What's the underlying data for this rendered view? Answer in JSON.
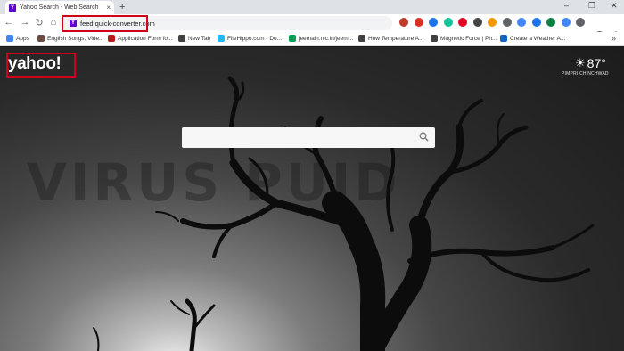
{
  "browser": {
    "tab_title": "Yahoo Search - Web Search",
    "tab_close": "×",
    "new_tab": "+",
    "window_controls": [
      "–",
      "❐",
      "✕"
    ],
    "url": "feed.quick-converter.com",
    "nav": {
      "back": "←",
      "forward": "→",
      "reload": "↻",
      "home": "⌂"
    },
    "menu": "⋮",
    "extensions": [
      {
        "name": "abp-icon",
        "color": "#c0392b"
      },
      {
        "name": "calendar-icon",
        "color": "#d93025"
      },
      {
        "name": "shield-icon",
        "color": "#1a73e8"
      },
      {
        "name": "grammarly-icon",
        "color": "#15c39a"
      },
      {
        "name": "pinterest-icon",
        "color": "#e60023"
      },
      {
        "name": "puzzle-icon",
        "color": "#444444"
      },
      {
        "name": "gear-icon",
        "color": "#f29900"
      },
      {
        "name": "s-icon",
        "color": "#5f6368"
      },
      {
        "name": "pen-icon",
        "color": "#4285f4"
      },
      {
        "name": "video-icon",
        "color": "#1a73e8"
      },
      {
        "name": "chat-icon",
        "color": "#0b8043"
      },
      {
        "name": "mail-icon",
        "color": "#4285f4"
      },
      {
        "name": "cast-icon",
        "color": "#5f6368"
      }
    ]
  },
  "bookmarks": {
    "items": [
      {
        "label": "Apps",
        "icon": "apps-icon",
        "color": "#4285f4"
      },
      {
        "label": "English Songs, Vide...",
        "icon": "bookmark-icon",
        "color": "#6d4c41"
      },
      {
        "label": "Application Form fo...",
        "icon": "globe-icon",
        "color": "#b71c1c"
      },
      {
        "label": "New Tab",
        "icon": "globe-icon",
        "color": "#424242"
      },
      {
        "label": "FileHippo.com - Do...",
        "icon": "hippo-icon",
        "color": "#29b6f6"
      },
      {
        "label": "jeemain.nic.in/jeem...",
        "icon": "chrome-icon",
        "color": "#0f9d58"
      },
      {
        "label": "How Temperature A...",
        "icon": "globe-icon",
        "color": "#424242"
      },
      {
        "label": "Magnetic Force | Ph...",
        "icon": "globe-icon",
        "color": "#424242"
      },
      {
        "label": "Create a Weather A...",
        "icon": "weather-icon",
        "color": "#1565c0"
      }
    ],
    "more": "»"
  },
  "page": {
    "logo": "yahoo!",
    "weather_temp": "87°",
    "weather_city": "PIMPRI CHINCHWAD",
    "search_placeholder": "",
    "watermark": "VIRUS PUID"
  }
}
